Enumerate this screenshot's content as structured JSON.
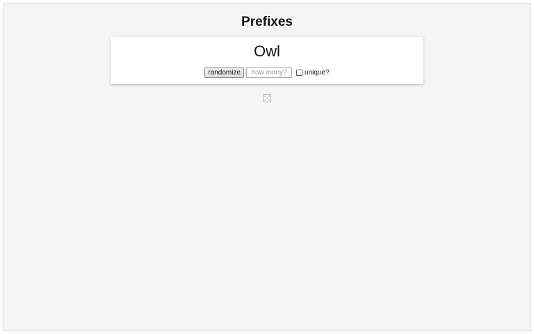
{
  "page": {
    "title": "Prefixes"
  },
  "generator": {
    "result": "Owl",
    "randomize_label": "randomize",
    "count_placeholder": "how many?",
    "count_value": "",
    "unique_label": "unique?",
    "unique_checked": false
  },
  "icons": {
    "dice": "dice-icon"
  },
  "colors": {
    "background": "#f5f5f5",
    "card": "#ffffff"
  }
}
